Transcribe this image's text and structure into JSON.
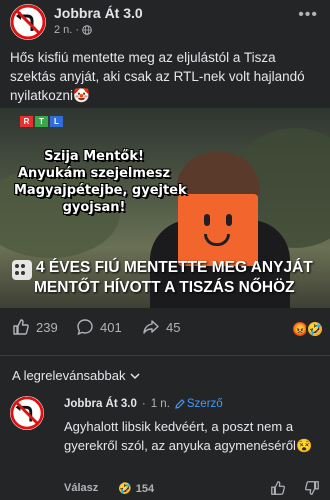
{
  "post": {
    "author": "Jobbra Át 3.0",
    "time": "2 n.",
    "more_label": "•••",
    "text": "Hős kisfiú mentette meg az eljulástól a Tisza szektás anyját, aki csak az RTL-nek volt hajlandó nyilatkozni🤡"
  },
  "media": {
    "channel_letters": [
      "R",
      "T",
      "L"
    ],
    "overlay_lines": [
      "Szija Mentők!",
      "Anyukám szejelmesz",
      "Magyajpétejbe, gyejtek",
      "gyojsan!"
    ],
    "ticker_lines": [
      "4 ÉVES FIÚ MENTETTE MEG ANYJÁT",
      "MENTŐT HÍVOTT A TISZÁS NŐHÖZ"
    ]
  },
  "actions": {
    "likes": "239",
    "comments": "401",
    "shares": "45",
    "reactions": [
      "😡",
      "🤣"
    ]
  },
  "comments_sort": {
    "label": "A legrelevánsabbak"
  },
  "comment": {
    "author": "Jobbra Át 3.0",
    "time": "1 n.",
    "badge": "Szerző",
    "text": "Agyhalott libsik kedvéért, a poszt nem a gyerekről szól, az anyuka agymenéséről😵",
    "reply_label": "Válasz",
    "reaction_emoji": "🤣",
    "reaction_count": "154"
  },
  "colors": {
    "background": "#242526",
    "text": "#e4e6eb",
    "muted": "#b0b3b8",
    "accent": "#4599ff",
    "ticker": "#ffffff"
  }
}
